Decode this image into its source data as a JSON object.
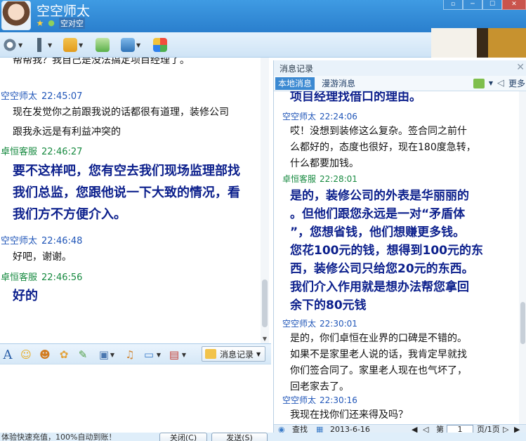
{
  "window": {
    "contact_name": "空空师太",
    "signature": "空对空",
    "banner_text": "",
    "winbtns": [
      "▫",
      "─",
      "☐",
      "✕"
    ]
  },
  "toolbar": {
    "icons": [
      "video-call-icon",
      "voice-call-icon",
      "file-transfer-icon",
      "add-friend-icon",
      "remote-desktop-icon",
      "apps-icon"
    ]
  },
  "left_chat": {
    "clipped_top": "帮帮我？我自己是没法搞定项目经理了。",
    "messages": [
      {
        "sender": "空空师太",
        "time": "22:45:07",
        "lines": [
          "现在发觉你之前跟我说的话都很有道理，装修公司",
          "跟我永远是有利益冲突的"
        ]
      },
      {
        "sender": "卓恒客服",
        "time": "22:46:27",
        "lines": [
          "要不这样吧，您有空去我们现场监理部找",
          "我们总监，您跟他说一下大致的情况，看",
          "我们方不方便介入。"
        ]
      },
      {
        "sender": "空空师太",
        "time": "22:46:48",
        "lines": [
          "好吧，谢谢。"
        ]
      },
      {
        "sender": "卓恒客服",
        "time": "22:46:56",
        "lines": [
          "好的"
        ]
      }
    ]
  },
  "input_toolbar": {
    "history_label": "消息记录"
  },
  "bottom": {
    "tip": "体验快速充值，100%自动到账！",
    "close_label": "关闭(C)",
    "send_label": "发送(S)"
  },
  "history": {
    "title": "消息记录",
    "tab_local": "本地消息",
    "tab_roam": "漫游消息",
    "more_label": "更多",
    "clipped_top": "项目经理找借口的理由。",
    "messages": [
      {
        "sender": "空空师太",
        "time": "22:24:06",
        "lines": [
          "哎！没想到装修这么复杂。签合同之前什",
          "么都好的，态度也很好，现在180度急转，",
          "什么都要加钱。"
        ]
      },
      {
        "sender": "卓恒客服",
        "time": "22:28:01",
        "lines": [
          "是的，装修公司的外表是华丽丽的",
          "。但他们跟您永远是一对“矛盾体",
          "”，您想省钱，他们想赚更多钱。",
          "您花100元的钱，想得到100元的东",
          "西，装修公司只给您20元的东西。",
          "我们介入作用就是想办法帮您拿回",
          "余下的80元钱"
        ]
      },
      {
        "sender": "空空师太",
        "time": "22:30:01",
        "lines": [
          "是的，你们卓恒在业界的口碑是不错的。",
          "如果不是家里老人说的话，我肯定早就找",
          "你们签合同了。家里老人现在也气坏了，",
          "回老家去了。"
        ]
      },
      {
        "sender": "空空师太",
        "time": "22:30:16",
        "lines": [
          "我现在找你们还来得及吗？"
        ]
      }
    ],
    "footer": {
      "find_label": "查找",
      "date": "2013-6-16",
      "page_prefix": "第",
      "page": "1",
      "page_suffix": "页/1页"
    }
  }
}
